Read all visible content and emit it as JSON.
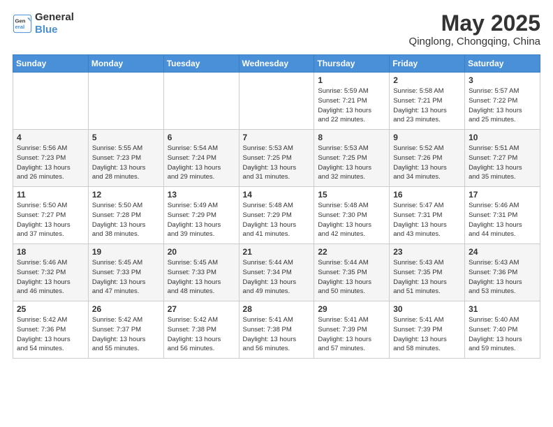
{
  "header": {
    "logo_line1": "General",
    "logo_line2": "Blue",
    "title": "May 2025",
    "subtitle": "Qinglong, Chongqing, China"
  },
  "weekdays": [
    "Sunday",
    "Monday",
    "Tuesday",
    "Wednesday",
    "Thursday",
    "Friday",
    "Saturday"
  ],
  "weeks": [
    [
      {
        "day": "",
        "info": ""
      },
      {
        "day": "",
        "info": ""
      },
      {
        "day": "",
        "info": ""
      },
      {
        "day": "",
        "info": ""
      },
      {
        "day": "1",
        "info": "Sunrise: 5:59 AM\nSunset: 7:21 PM\nDaylight: 13 hours\nand 22 minutes."
      },
      {
        "day": "2",
        "info": "Sunrise: 5:58 AM\nSunset: 7:21 PM\nDaylight: 13 hours\nand 23 minutes."
      },
      {
        "day": "3",
        "info": "Sunrise: 5:57 AM\nSunset: 7:22 PM\nDaylight: 13 hours\nand 25 minutes."
      }
    ],
    [
      {
        "day": "4",
        "info": "Sunrise: 5:56 AM\nSunset: 7:23 PM\nDaylight: 13 hours\nand 26 minutes."
      },
      {
        "day": "5",
        "info": "Sunrise: 5:55 AM\nSunset: 7:23 PM\nDaylight: 13 hours\nand 28 minutes."
      },
      {
        "day": "6",
        "info": "Sunrise: 5:54 AM\nSunset: 7:24 PM\nDaylight: 13 hours\nand 29 minutes."
      },
      {
        "day": "7",
        "info": "Sunrise: 5:53 AM\nSunset: 7:25 PM\nDaylight: 13 hours\nand 31 minutes."
      },
      {
        "day": "8",
        "info": "Sunrise: 5:53 AM\nSunset: 7:25 PM\nDaylight: 13 hours\nand 32 minutes."
      },
      {
        "day": "9",
        "info": "Sunrise: 5:52 AM\nSunset: 7:26 PM\nDaylight: 13 hours\nand 34 minutes."
      },
      {
        "day": "10",
        "info": "Sunrise: 5:51 AM\nSunset: 7:27 PM\nDaylight: 13 hours\nand 35 minutes."
      }
    ],
    [
      {
        "day": "11",
        "info": "Sunrise: 5:50 AM\nSunset: 7:27 PM\nDaylight: 13 hours\nand 37 minutes."
      },
      {
        "day": "12",
        "info": "Sunrise: 5:50 AM\nSunset: 7:28 PM\nDaylight: 13 hours\nand 38 minutes."
      },
      {
        "day": "13",
        "info": "Sunrise: 5:49 AM\nSunset: 7:29 PM\nDaylight: 13 hours\nand 39 minutes."
      },
      {
        "day": "14",
        "info": "Sunrise: 5:48 AM\nSunset: 7:29 PM\nDaylight: 13 hours\nand 41 minutes."
      },
      {
        "day": "15",
        "info": "Sunrise: 5:48 AM\nSunset: 7:30 PM\nDaylight: 13 hours\nand 42 minutes."
      },
      {
        "day": "16",
        "info": "Sunrise: 5:47 AM\nSunset: 7:31 PM\nDaylight: 13 hours\nand 43 minutes."
      },
      {
        "day": "17",
        "info": "Sunrise: 5:46 AM\nSunset: 7:31 PM\nDaylight: 13 hours\nand 44 minutes."
      }
    ],
    [
      {
        "day": "18",
        "info": "Sunrise: 5:46 AM\nSunset: 7:32 PM\nDaylight: 13 hours\nand 46 minutes."
      },
      {
        "day": "19",
        "info": "Sunrise: 5:45 AM\nSunset: 7:33 PM\nDaylight: 13 hours\nand 47 minutes."
      },
      {
        "day": "20",
        "info": "Sunrise: 5:45 AM\nSunset: 7:33 PM\nDaylight: 13 hours\nand 48 minutes."
      },
      {
        "day": "21",
        "info": "Sunrise: 5:44 AM\nSunset: 7:34 PM\nDaylight: 13 hours\nand 49 minutes."
      },
      {
        "day": "22",
        "info": "Sunrise: 5:44 AM\nSunset: 7:35 PM\nDaylight: 13 hours\nand 50 minutes."
      },
      {
        "day": "23",
        "info": "Sunrise: 5:43 AM\nSunset: 7:35 PM\nDaylight: 13 hours\nand 51 minutes."
      },
      {
        "day": "24",
        "info": "Sunrise: 5:43 AM\nSunset: 7:36 PM\nDaylight: 13 hours\nand 53 minutes."
      }
    ],
    [
      {
        "day": "25",
        "info": "Sunrise: 5:42 AM\nSunset: 7:36 PM\nDaylight: 13 hours\nand 54 minutes."
      },
      {
        "day": "26",
        "info": "Sunrise: 5:42 AM\nSunset: 7:37 PM\nDaylight: 13 hours\nand 55 minutes."
      },
      {
        "day": "27",
        "info": "Sunrise: 5:42 AM\nSunset: 7:38 PM\nDaylight: 13 hours\nand 56 minutes."
      },
      {
        "day": "28",
        "info": "Sunrise: 5:41 AM\nSunset: 7:38 PM\nDaylight: 13 hours\nand 56 minutes."
      },
      {
        "day": "29",
        "info": "Sunrise: 5:41 AM\nSunset: 7:39 PM\nDaylight: 13 hours\nand 57 minutes."
      },
      {
        "day": "30",
        "info": "Sunrise: 5:41 AM\nSunset: 7:39 PM\nDaylight: 13 hours\nand 58 minutes."
      },
      {
        "day": "31",
        "info": "Sunrise: 5:40 AM\nSunset: 7:40 PM\nDaylight: 13 hours\nand 59 minutes."
      }
    ]
  ]
}
